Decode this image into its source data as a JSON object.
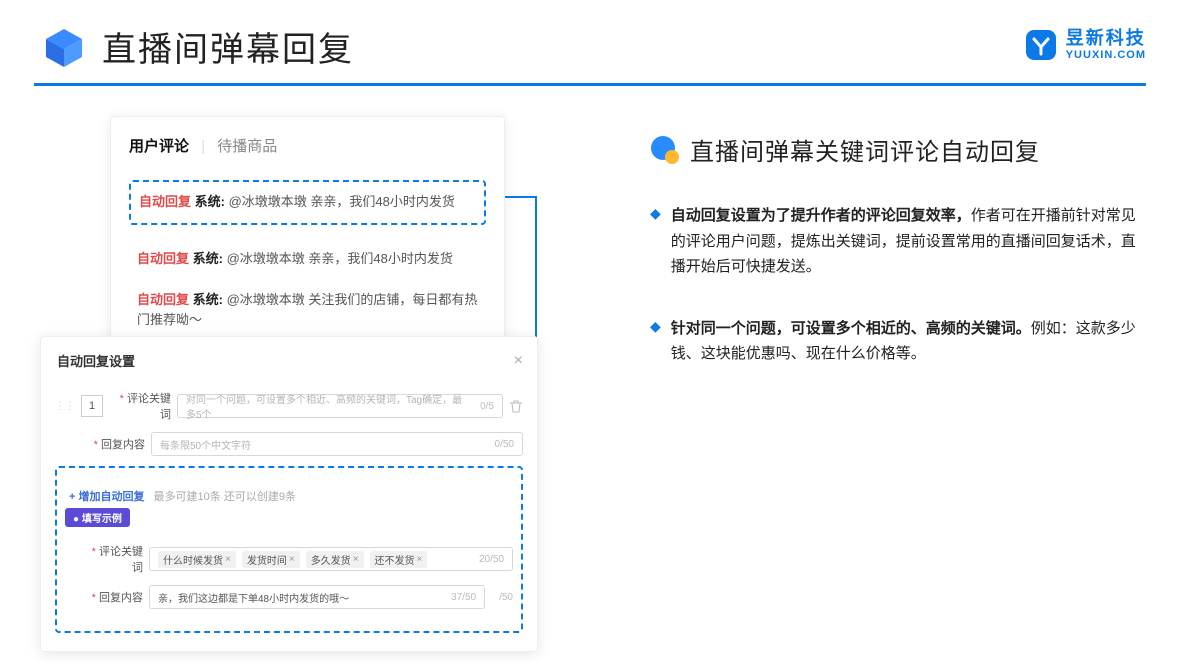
{
  "header": {
    "title": "直播间弹幕回复",
    "brand_cn": "昱新科技",
    "brand_en": "YUUXIN.COM"
  },
  "comments_panel": {
    "tab_active": "用户评论",
    "tab_inactive": "待播商品",
    "msg_label": "自动回复",
    "msg_sys_prefix": "系统:",
    "msg1": "@冰墩墩本墩 亲亲，我们48小时内发货",
    "msg2": "@冰墩墩本墩 亲亲，我们48小时内发货",
    "msg3": "@冰墩墩本墩 关注我们的店铺，每日都有热门推荐呦～"
  },
  "settings_panel": {
    "title": "自动回复设置",
    "seq": "1",
    "lbl_keyword": "评论关键词",
    "ph_keyword": "对同一个问题，可设置多个相近、高频的关键词，Tag确定，最多5个",
    "cnt_keyword": "0/5",
    "lbl_content": "回复内容",
    "ph_content": "每条限50个中文字符",
    "cnt_content": "0/50",
    "add_label": "+ 增加自动回复",
    "add_hint": "最多可建10条 还可以创建9条",
    "example_badge": "● 填写示例",
    "ex_lbl_keyword": "评论关键词",
    "ex_tags": [
      "什么时候发货",
      "发货时间",
      "多久发货",
      "还不发货"
    ],
    "ex_cnt_keyword": "20/50",
    "ex_lbl_content": "回复内容",
    "ex_content": "亲，我们这边都是下单48小时内发货的哦～",
    "ex_cnt_content": "37/50",
    "ex_cnt_content2": "/50"
  },
  "right": {
    "section_title": "直播间弹幕关键词评论自动回复",
    "p1a": "自动回复设置为了提升作者的评论回复效率，",
    "p1b": "作者可在开播前针对常见的评论用户问题，提炼出关键词，提前设置常用的直播间回复话术，直播开始后可快捷发送。",
    "p2a": "针对同一个问题，可设置多个相近的、高频的关键词。",
    "p2b": "例如：这款多少钱、这块能优惠吗、现在什么价格等。"
  }
}
